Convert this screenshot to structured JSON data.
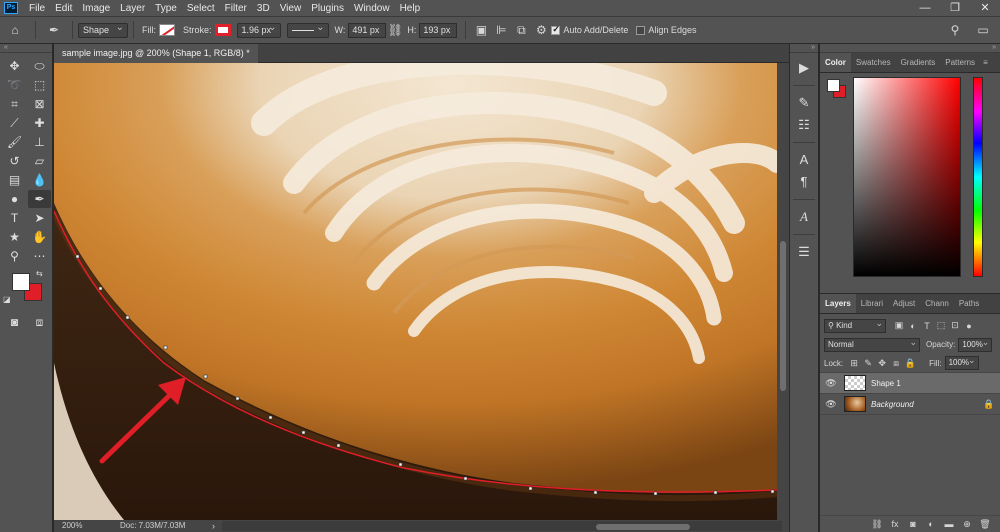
{
  "app": {
    "logo": "Ps"
  },
  "menu": [
    "File",
    "Edit",
    "Image",
    "Layer",
    "Type",
    "Select",
    "Filter",
    "3D",
    "View",
    "Plugins",
    "Window",
    "Help"
  ],
  "window_controls": {
    "minimize": "—",
    "maximize": "❐",
    "close": "✕"
  },
  "options": {
    "mode": "Shape",
    "fill_label": "Fill:",
    "stroke_label": "Stroke:",
    "stroke_width": "1.96 px",
    "w_label": "W:",
    "w_value": "491 px",
    "h_label": "H:",
    "h_value": "193 px",
    "auto_add_delete": "Auto Add/Delete",
    "align_edges": "Align Edges",
    "fill_color": "#ffffff",
    "stroke_color": "#e0202a"
  },
  "document": {
    "tab_title": "sample image.jpg @ 200% (Shape 1, RGB/8) *",
    "zoom": "200%",
    "doc_size": "Doc: 7.03M/7.03M"
  },
  "colors": {
    "foreground": "#ffffff",
    "background": "#e01e28"
  },
  "color_panel": {
    "tabs": [
      "Color",
      "Swatches",
      "Gradients",
      "Patterns"
    ]
  },
  "layers_panel": {
    "tabs": [
      "Layers",
      "Librari",
      "Adjust",
      "Chann",
      "Paths"
    ],
    "filter_kind": "Kind",
    "blend_mode": "Normal",
    "opacity_label": "Opacity:",
    "opacity_value": "100%",
    "lock_label": "Lock:",
    "fill_label": "Fill:",
    "fill_value": "100%",
    "layers": [
      {
        "name": "Shape 1",
        "selected": true
      },
      {
        "name": "Background",
        "selected": false
      }
    ]
  },
  "annotation": {
    "arrow_color": "#e01e28"
  }
}
